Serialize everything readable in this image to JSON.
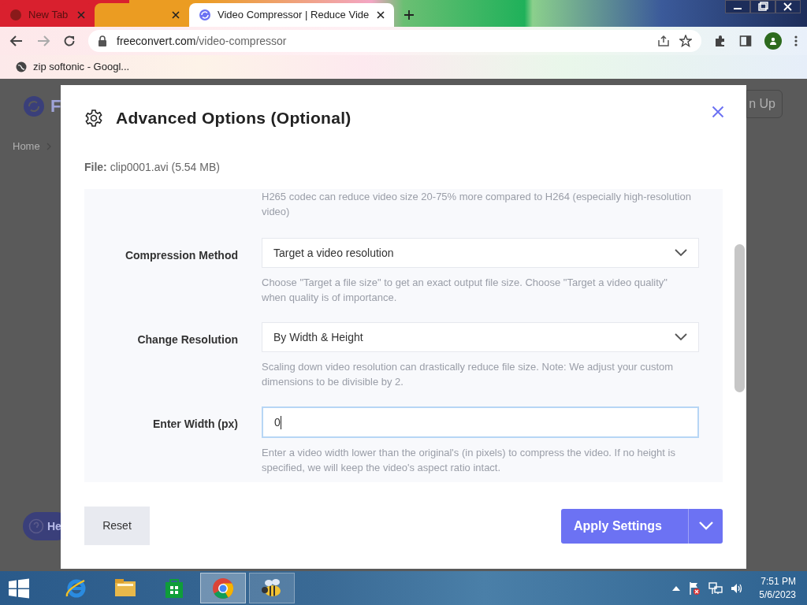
{
  "browser": {
    "tabs": [
      {
        "title": "New Tab",
        "selected": false,
        "color": "#d9202e"
      },
      {
        "selected": false,
        "color": "#eb9c22"
      },
      {
        "title": "Video Compressor | Reduce Vide",
        "selected": true
      }
    ],
    "address": {
      "host": "freeconvert.com",
      "path": "/video-compressor"
    },
    "bookmarks": [
      {
        "title": "zip softonic - Googl..."
      }
    ]
  },
  "background_page": {
    "logo_text": "F",
    "breadcrumb": "Home",
    "signup_button": "n Up",
    "help_button": "He"
  },
  "dialog": {
    "title": "Advanced Options (Optional)",
    "file_label": "File:",
    "file_value": "clip0001.avi (5.54 MB)",
    "settings": [
      {
        "kind": "help",
        "help": "H265 codec can reduce video size 20-75% more compared to H264 (especially high-resolution video)"
      },
      {
        "kind": "select",
        "label": "Compression Method",
        "value": "Target a video resolution",
        "help": "Choose \"Target a file size\" to get an exact output file size. Choose \"Target a video quality\" when quality is of importance."
      },
      {
        "kind": "select",
        "label": "Change Resolution",
        "value": "By Width & Height",
        "help": "Scaling down video resolution can drastically reduce file size. Note: We adjust your custom dimensions to be divisible by 2."
      },
      {
        "kind": "input",
        "label": "Enter Width (px)",
        "value": "0",
        "focused": true,
        "help": "Enter a video width lower than the original's (in pixels) to compress the video. If no height is specified, we will keep the video's aspect ratio intact."
      }
    ],
    "reset_button": "Reset",
    "apply_button": "Apply Settings"
  },
  "taskbar": {
    "apps": [
      {
        "kind": "ie",
        "selected": false
      },
      {
        "kind": "explorer",
        "selected": false
      },
      {
        "kind": "store",
        "selected": false
      },
      {
        "kind": "chrome",
        "selected": true
      },
      {
        "kind": "bee",
        "selected": false
      }
    ],
    "time": "7:51 PM",
    "date": "5/6/2023"
  }
}
